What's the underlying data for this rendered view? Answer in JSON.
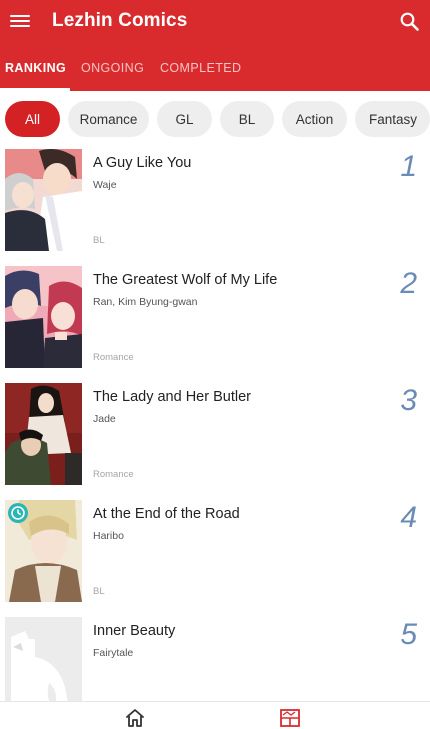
{
  "header": {
    "app_title": "Lezhin Comics",
    "icons": {
      "menu": "menu-icon",
      "search": "search-icon"
    }
  },
  "tabs": [
    {
      "label": "RANKING",
      "active": true
    },
    {
      "label": "ONGOING",
      "active": false
    },
    {
      "label": "COMPLETED",
      "active": false
    }
  ],
  "genre_filters": [
    {
      "label": "All",
      "active": true
    },
    {
      "label": "Romance",
      "active": false
    },
    {
      "label": "GL",
      "active": false
    },
    {
      "label": "BL",
      "active": false
    },
    {
      "label": "Action",
      "active": false
    },
    {
      "label": "Fantasy",
      "active": false
    }
  ],
  "comics": [
    {
      "rank": "1",
      "title": "A Guy Like You",
      "author": "Waje",
      "genre": "BL"
    },
    {
      "rank": "2",
      "title": "The Greatest Wolf of My Life",
      "author": "Ran, Kim Byung-gwan",
      "genre": "Romance"
    },
    {
      "rank": "3",
      "title": "The Lady and Her Butler",
      "author": "Jade",
      "genre": "Romance"
    },
    {
      "rank": "4",
      "title": "At the End of the Road",
      "author": "Haribo",
      "genre": "BL"
    },
    {
      "rank": "5",
      "title": "Inner Beauty",
      "author": "Fairytale",
      "genre": ""
    }
  ],
  "bottom_nav": {
    "home": "home-icon",
    "ranking": "ranking-icon"
  },
  "colors": {
    "brand": "#d92b2d",
    "rank_number": "#6a8bb5",
    "chip_active": "#d32124",
    "chip_inactive": "#eeeeee"
  }
}
